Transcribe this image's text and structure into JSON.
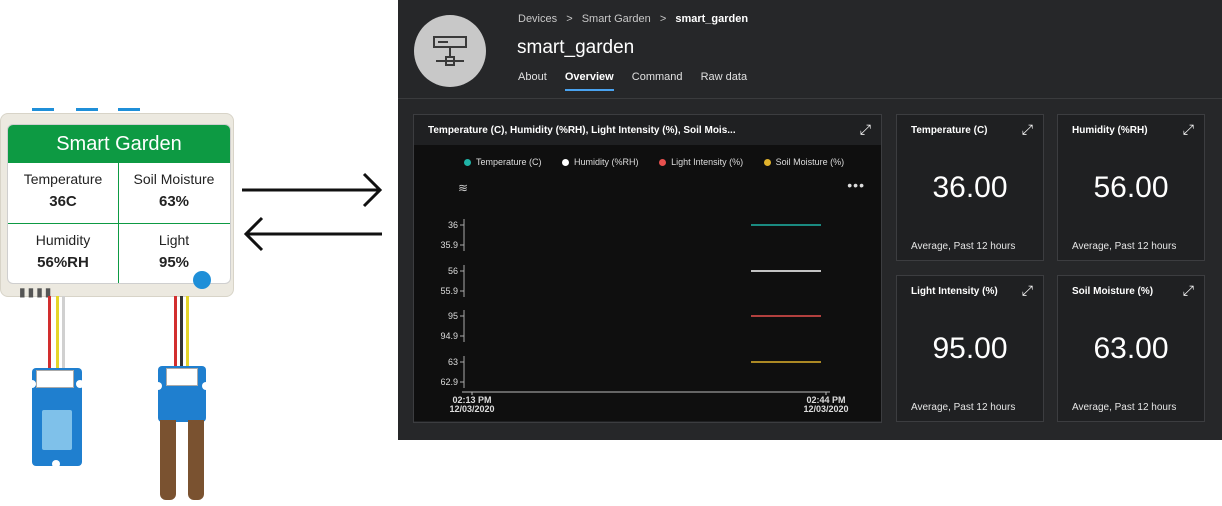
{
  "device": {
    "title": "Smart Garden",
    "cells": [
      {
        "label": "Temperature",
        "value": "36C"
      },
      {
        "label": "Soil Moisture",
        "value": "63%"
      },
      {
        "label": "Humidity",
        "value": "56%RH"
      },
      {
        "label": "Light",
        "value": "95%"
      }
    ]
  },
  "panel": {
    "breadcrumb": [
      "Devices",
      "Smart Garden",
      "smart_garden"
    ],
    "breadcrumb_sep": ">",
    "device_name": "smart_garden",
    "tabs": [
      "About",
      "Overview",
      "Command",
      "Raw data"
    ],
    "active_tab": "Overview",
    "chart_tile_title": "Temperature (C), Humidity (%RH), Light Intensity (%), Soil Mois...",
    "kpis": [
      {
        "title": "Temperature (C)",
        "value": "36.00",
        "subtitle": "Average, Past 12 hours"
      },
      {
        "title": "Humidity (%RH)",
        "value": "56.00",
        "subtitle": "Average, Past 12 hours"
      },
      {
        "title": "Light Intensity (%)",
        "value": "95.00",
        "subtitle": "Average, Past 12 hours"
      },
      {
        "title": "Soil Moisture (%)",
        "value": "63.00",
        "subtitle": "Average, Past 12 hours"
      }
    ],
    "icons": {
      "expand": "expand-icon",
      "layers": "layers-icon",
      "more": "more-icon",
      "device": "device-icon"
    }
  },
  "colors": {
    "temperature": "#1fb3a6",
    "humidity": "#ffffff",
    "light": "#e8504e",
    "soil": "#e0b22c",
    "accent": "#4aa3f0",
    "device_green": "#0d9a43"
  },
  "chart_data": {
    "type": "line",
    "x_start_label": [
      "02:13 PM",
      "12/03/2020"
    ],
    "x_end_label": [
      "02:44 PM",
      "12/03/2020"
    ],
    "series": [
      {
        "name": "Temperature (C)",
        "ticks": [
          "36",
          "35.9"
        ],
        "value": 36
      },
      {
        "name": "Humidity (%RH)",
        "ticks": [
          "56",
          "55.9"
        ],
        "value": 56
      },
      {
        "name": "Light Intensity (%)",
        "ticks": [
          "95",
          "94.9"
        ],
        "value": 95
      },
      {
        "name": "Soil Moisture (%)",
        "ticks": [
          "63",
          "62.9"
        ],
        "value": 63
      }
    ]
  }
}
